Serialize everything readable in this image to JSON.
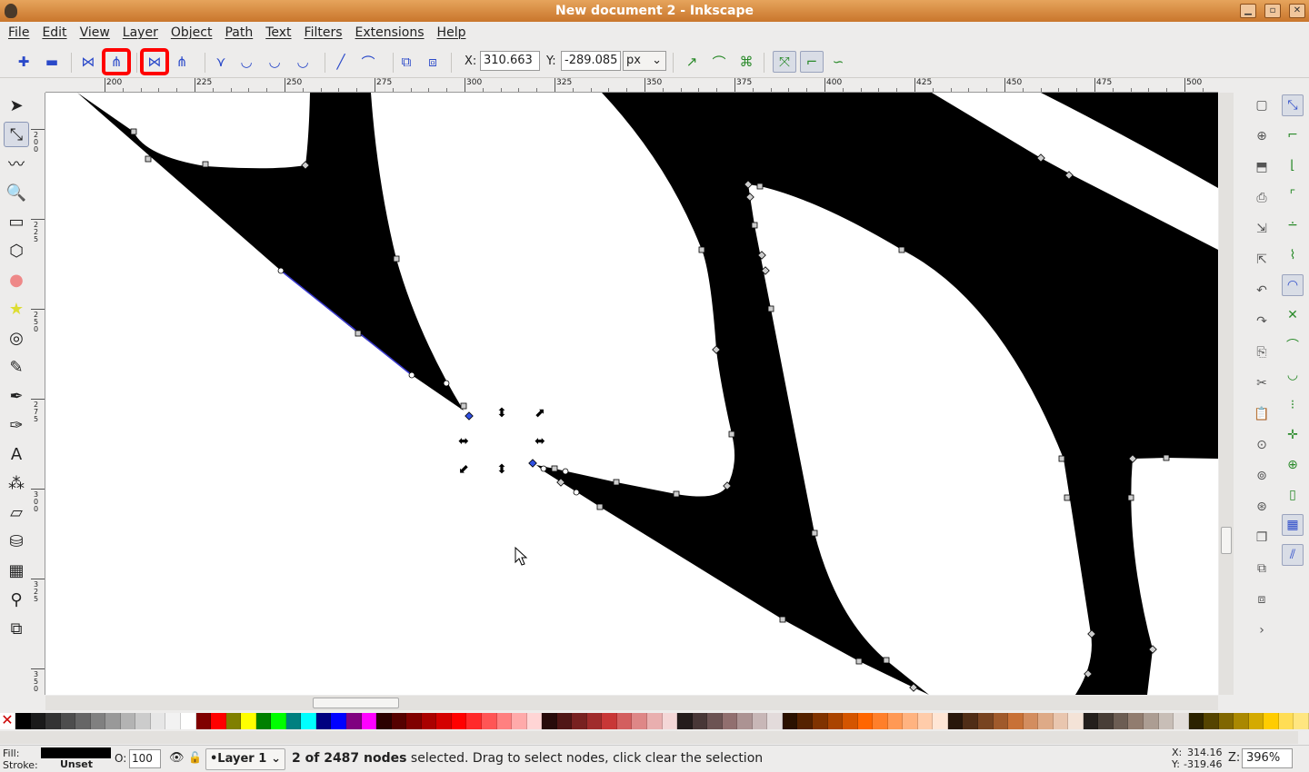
{
  "window": {
    "title": "New document 2 - Inkscape",
    "minimize": "▁",
    "maximize": "▫",
    "close": "✕"
  },
  "menu": [
    "File",
    "Edit",
    "View",
    "Layer",
    "Object",
    "Path",
    "Text",
    "Filters",
    "Extensions",
    "Help"
  ],
  "node_toolbar": {
    "buttons": [
      {
        "name": "insert-node",
        "glyph": "✚"
      },
      {
        "name": "delete-node",
        "glyph": "▬"
      },
      {
        "name": "join-nodes",
        "glyph": "⋈",
        "highlighted": false
      },
      {
        "name": "break-path",
        "glyph": "⋔",
        "highlighted": true
      },
      {
        "name": "join-with-segment",
        "glyph": "⋈",
        "highlighted": true
      },
      {
        "name": "delete-segment",
        "glyph": "⋔",
        "highlighted": false
      },
      {
        "name": "make-cusp",
        "glyph": "⋎"
      },
      {
        "name": "make-smooth",
        "glyph": "◡"
      },
      {
        "name": "make-symmetric",
        "glyph": "◡"
      },
      {
        "name": "make-auto-smooth",
        "glyph": "◡"
      },
      {
        "name": "make-line",
        "glyph": "╱"
      },
      {
        "name": "make-curve",
        "glyph": "⌒"
      },
      {
        "name": "object-to-path",
        "glyph": "⧉"
      },
      {
        "name": "stroke-to-path",
        "glyph": "⧈"
      }
    ],
    "x_label": "X:",
    "x_value": "310.663",
    "y_label": "Y:",
    "y_value": "-289.085",
    "unit": "px",
    "extra_buttons": [
      "show-path-effect",
      "show-handles-outline",
      "edit-clip-mask",
      "show-transform-handles",
      "show-handles",
      "show-outline"
    ]
  },
  "ruler": {
    "top_labels": [
      "200",
      "225",
      "250",
      "275",
      "300",
      "325",
      "350",
      "375",
      "400",
      "425",
      "450",
      "475",
      "500"
    ],
    "left_labels": [
      "200",
      "225",
      "250",
      "275",
      "300",
      "325",
      "350"
    ]
  },
  "tools": [
    "selector",
    "node",
    "tweak",
    "zoom",
    "rectangle",
    "3d-box",
    "ellipse",
    "star",
    "spiral",
    "pencil",
    "pen",
    "calligraphy",
    "text",
    "spray",
    "eraser",
    "paint-bucket",
    "gradient",
    "dropper",
    "connector"
  ],
  "active_tool": "node",
  "commands": [
    "new",
    "open",
    "save",
    "print",
    "import",
    "export",
    "undo",
    "redo",
    "copy",
    "cut",
    "paste",
    "zoom-selection",
    "zoom-drawing",
    "zoom-page",
    "duplicate",
    "clone",
    "unlink-clone",
    "more"
  ],
  "snap": [
    "snap-toggle",
    "snap-bbox",
    "snap-bbox-edge",
    "snap-bbox-corner",
    "snap-bbox-midpoint",
    "snap-nodes",
    "snap-paths",
    "snap-path-intersection",
    "snap-cusp",
    "snap-smooth",
    "snap-midpoint",
    "snap-center",
    "snap-rotation-center",
    "snap-page",
    "snap-grid",
    "snap-guide"
  ],
  "palette": [
    "#000000",
    "#1a1a1a",
    "#333333",
    "#4d4d4d",
    "#666666",
    "#808080",
    "#999999",
    "#b3b3b3",
    "#cccccc",
    "#e6e6e6",
    "#f2f2f2",
    "#ffffff",
    "#800000",
    "#ff0000",
    "#808000",
    "#ffff00",
    "#008000",
    "#00ff00",
    "#008080",
    "#00ffff",
    "#000080",
    "#0000ff",
    "#800080",
    "#ff00ff",
    "#2b0000",
    "#550000",
    "#800000",
    "#aa0000",
    "#d40000",
    "#ff0000",
    "#ff2a2a",
    "#ff5555",
    "#ff8080",
    "#ffaaaa",
    "#ffd5d5",
    "#280b0b",
    "#501616",
    "#782121",
    "#a02c2c",
    "#c83737",
    "#d35f5f",
    "#de8787",
    "#e9afaf",
    "#f4d7d7",
    "#241c1c",
    "#483737",
    "#6c5353",
    "#916f6f",
    "#ac9393",
    "#c8b7b7",
    "#e3dbdb",
    "#2b1100",
    "#552200",
    "#803300",
    "#aa4400",
    "#d45500",
    "#ff6600",
    "#ff7f2a",
    "#ff9955",
    "#ffb380",
    "#ffccaa",
    "#ffe6d5",
    "#28170b",
    "#502d16",
    "#784421",
    "#a05a2c",
    "#c87137",
    "#d38d5f",
    "#deaa87",
    "#e9c6af",
    "#f4e3d7",
    "#241f1c",
    "#483e37",
    "#6c5d53",
    "#917c6f",
    "#ac9d93",
    "#c8beb7",
    "#e3dedb",
    "#2b2200",
    "#554400",
    "#806600",
    "#aa8800",
    "#d4aa00",
    "#ffcc00",
    "#ffdd55",
    "#ffe680"
  ],
  "status": {
    "fill_label": "Fill:",
    "stroke_label": "Stroke:",
    "fill_color": "#000000",
    "stroke_value": "Unset",
    "opacity_label": "O:",
    "opacity_value": "100",
    "layer": "•Layer 1",
    "message_bold": "2 of 2487 nodes",
    "message_rest": " selected. Drag to select nodes, click clear the selection",
    "cursor_x_label": "X:",
    "cursor_x": "314.16",
    "cursor_y_label": "Y:",
    "cursor_y": "-319.46",
    "zoom_label": "Z:",
    "zoom_value": "396%"
  }
}
